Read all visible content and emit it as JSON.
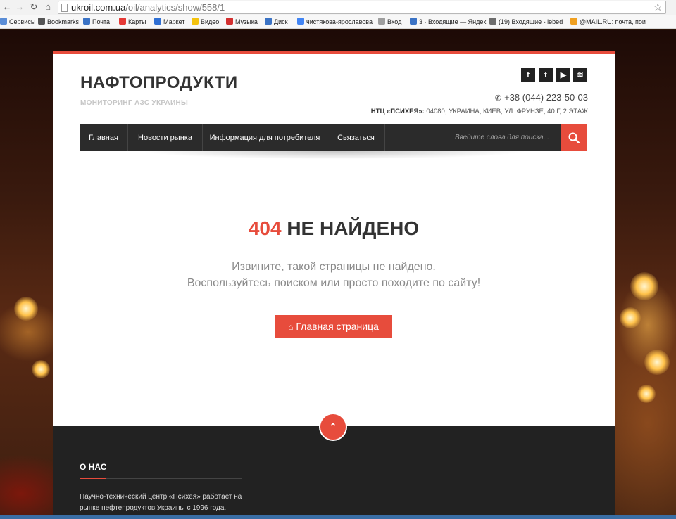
{
  "browser": {
    "url_host": "ukroil.com.ua",
    "url_path": "/oil/analytics/show/558/1",
    "bookmarks": [
      {
        "label": "Сервисы",
        "color": "#5a8dd6"
      },
      {
        "label": "Bookmarks",
        "color": "#555555"
      },
      {
        "label": "Почта",
        "color": "#3b73c5"
      },
      {
        "label": "Карты",
        "color": "#e53935"
      },
      {
        "label": "Маркет",
        "color": "#2f6fd3"
      },
      {
        "label": "Видео",
        "color": "#f4c20d"
      },
      {
        "label": "Музыка",
        "color": "#d32f2f"
      },
      {
        "label": "Диск",
        "color": "#3b73c5"
      },
      {
        "label": "чистякова-ярославова",
        "color": "#4285f4"
      },
      {
        "label": "Вход",
        "color": "#9e9e9e"
      },
      {
        "label": "3 · Входящие — Яндек",
        "color": "#3b73c5"
      },
      {
        "label": "(19) Входящие - lebed",
        "color": "#6d6d6d"
      },
      {
        "label": "@MAIL.RU: почта, пои",
        "color": "#f0a020"
      }
    ]
  },
  "site": {
    "title": "НАФТОПРОДУКТИ",
    "subtitle": "МОНИТОРИНГ АЗС УКРАИНЫ",
    "social": [
      "f",
      "t",
      "▶",
      "≋"
    ],
    "phone": "+38 (044) 223-50-03",
    "address_label": "НТЦ «ПСИХЕЯ»:",
    "address_text": "04080, УКРАИНА, КИЕВ, УЛ. ФРУНЗЕ, 40 Г, 2 ЭТАЖ",
    "accent_color": "#e74c3c"
  },
  "nav": {
    "items": [
      "Главная",
      "Новости рынка",
      "Информация для потребителя",
      "Связаться"
    ],
    "search_placeholder": "Введите слова для поиска..."
  },
  "error": {
    "code": "404",
    "title": "НЕ НАЙДЕНО",
    "line1": "Извините, такой страницы не найдено.",
    "line2": "Воспользуйтесь поиском или просто походите по сайту!",
    "button_label": "Главная страница"
  },
  "footer": {
    "heading": "О НАС",
    "text": "Научно-технический центр «Психея» работает на рынке нефтепродуктов Украины с 1996 года."
  }
}
